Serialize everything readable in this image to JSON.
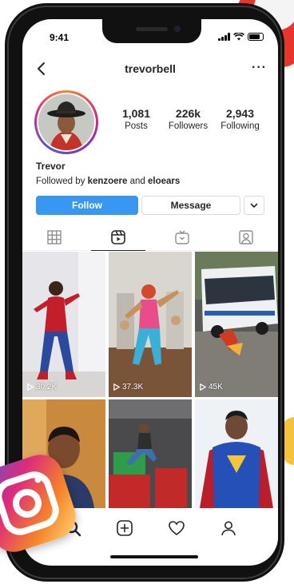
{
  "status": {
    "time": "9:41"
  },
  "header": {
    "username": "trevorbell",
    "more_label": "···"
  },
  "profile": {
    "display_name": "Trevor",
    "followed_prefix": "Followed by ",
    "followed_user_1": "kenzoere",
    "followed_and": " and ",
    "followed_user_2": "eloears"
  },
  "stats": [
    {
      "value": "1,081",
      "label": "Posts"
    },
    {
      "value": "226k",
      "label": "Followers"
    },
    {
      "value": "2,943",
      "label": "Following"
    }
  ],
  "buttons": {
    "follow": "Follow",
    "message": "Message"
  },
  "tabs": [
    {
      "icon": "grid-icon",
      "active": false
    },
    {
      "icon": "reels-icon",
      "active": true
    },
    {
      "icon": "igtv-icon",
      "active": false
    },
    {
      "icon": "tagged-icon",
      "active": false
    }
  ],
  "reels": [
    {
      "views": "30.2K"
    },
    {
      "views": "37.3K"
    },
    {
      "views": "45K"
    },
    {
      "views": ""
    },
    {
      "views": ""
    },
    {
      "views": ""
    }
  ],
  "bottom_nav": [
    "search-icon",
    "add-post-icon",
    "activity-heart-icon",
    "profile-icon"
  ],
  "colors": {
    "follow_blue": "#3897f0",
    "text": "#262626",
    "border": "#dbdbdb"
  }
}
